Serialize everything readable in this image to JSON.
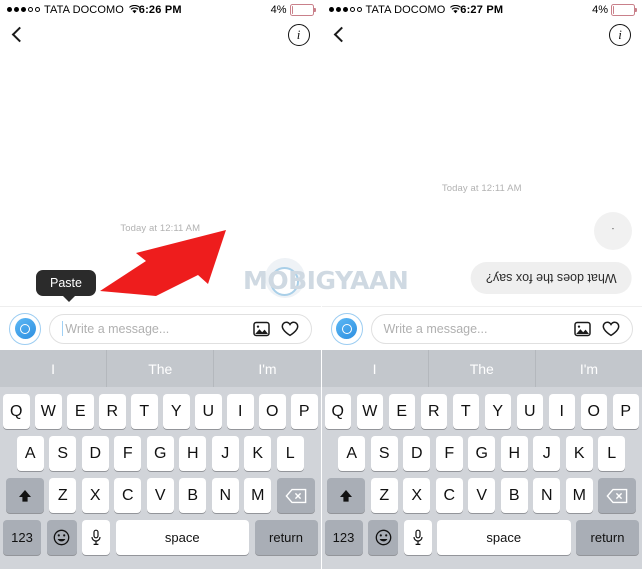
{
  "panels": [
    {
      "id": "left",
      "status": {
        "carrier": "TATA DOCOMO",
        "time": "6:26 PM",
        "battery_pct": "4%",
        "signal_filled": 3,
        "signal_hollow": 2,
        "wifi_icon": "wifi-icon"
      },
      "nav": {
        "back_icon": "back-chevron-icon",
        "info_label": "i",
        "info_icon": "info-circle-icon"
      },
      "conversation": {
        "timestamp": "Today at 12:11 AM",
        "bubbles": []
      },
      "tooltip": {
        "label": "Paste",
        "visible": true
      },
      "annotation": {
        "arrow_color": "#ee1d1d",
        "arrow_name": "red-pointer-arrow"
      },
      "input": {
        "camera_icon": "camera-icon",
        "placeholder": "Write a message...",
        "photo_icon": "photo-icon",
        "heart_icon": "heart-icon",
        "caret_visible": true
      }
    },
    {
      "id": "right",
      "status": {
        "carrier": "TATA DOCOMO",
        "time": "6:27 PM",
        "battery_pct": "4%",
        "signal_filled": 3,
        "signal_hollow": 2,
        "wifi_icon": "wifi-icon"
      },
      "nav": {
        "back_icon": "back-chevron-icon",
        "info_label": "i",
        "info_icon": "info-circle-icon"
      },
      "conversation": {
        "timestamp": "Today at 12:11 AM",
        "bubbles": [
          {
            "text": ".",
            "shape": "circle",
            "align": "right",
            "flipped": true
          },
          {
            "text": "What does the fox say?",
            "shape": "pill",
            "align": "right",
            "flipped": true
          }
        ]
      },
      "tooltip": {
        "label": "",
        "visible": false
      },
      "input": {
        "camera_icon": "camera-icon",
        "placeholder": "Write a message...",
        "photo_icon": "photo-icon",
        "heart_icon": "heart-icon",
        "caret_visible": false
      }
    }
  ],
  "keyboard": {
    "suggestions": [
      "I",
      "The",
      "I'm"
    ],
    "row1": [
      "Q",
      "W",
      "E",
      "R",
      "T",
      "Y",
      "U",
      "I",
      "O",
      "P"
    ],
    "row2": [
      "A",
      "S",
      "D",
      "F",
      "G",
      "H",
      "J",
      "K",
      "L"
    ],
    "row3": [
      "Z",
      "X",
      "C",
      "V",
      "B",
      "N",
      "M"
    ],
    "shift_icon": "shift-up-arrow-icon",
    "backspace_icon": "backspace-delete-icon",
    "numbers_label": "123",
    "emoji_icon": "emoji-smiley-icon",
    "emoji_glyph": "☺",
    "mic_icon": "microphone-icon",
    "space_label": "space",
    "return_label": "return"
  },
  "watermark": {
    "text": "MOBIGYAAN",
    "name": "mobigyaan-watermark"
  },
  "colors": {
    "accent_blue": "#2e8fe0",
    "bubble_gray": "#efefef",
    "keyboard_bg": "#d1d4d9",
    "suggestion_bg": "#c3c7cc",
    "key_gray": "#a9aeb6",
    "tooltip_bg": "#2b2b2b",
    "arrow_red": "#ee1d1d"
  }
}
